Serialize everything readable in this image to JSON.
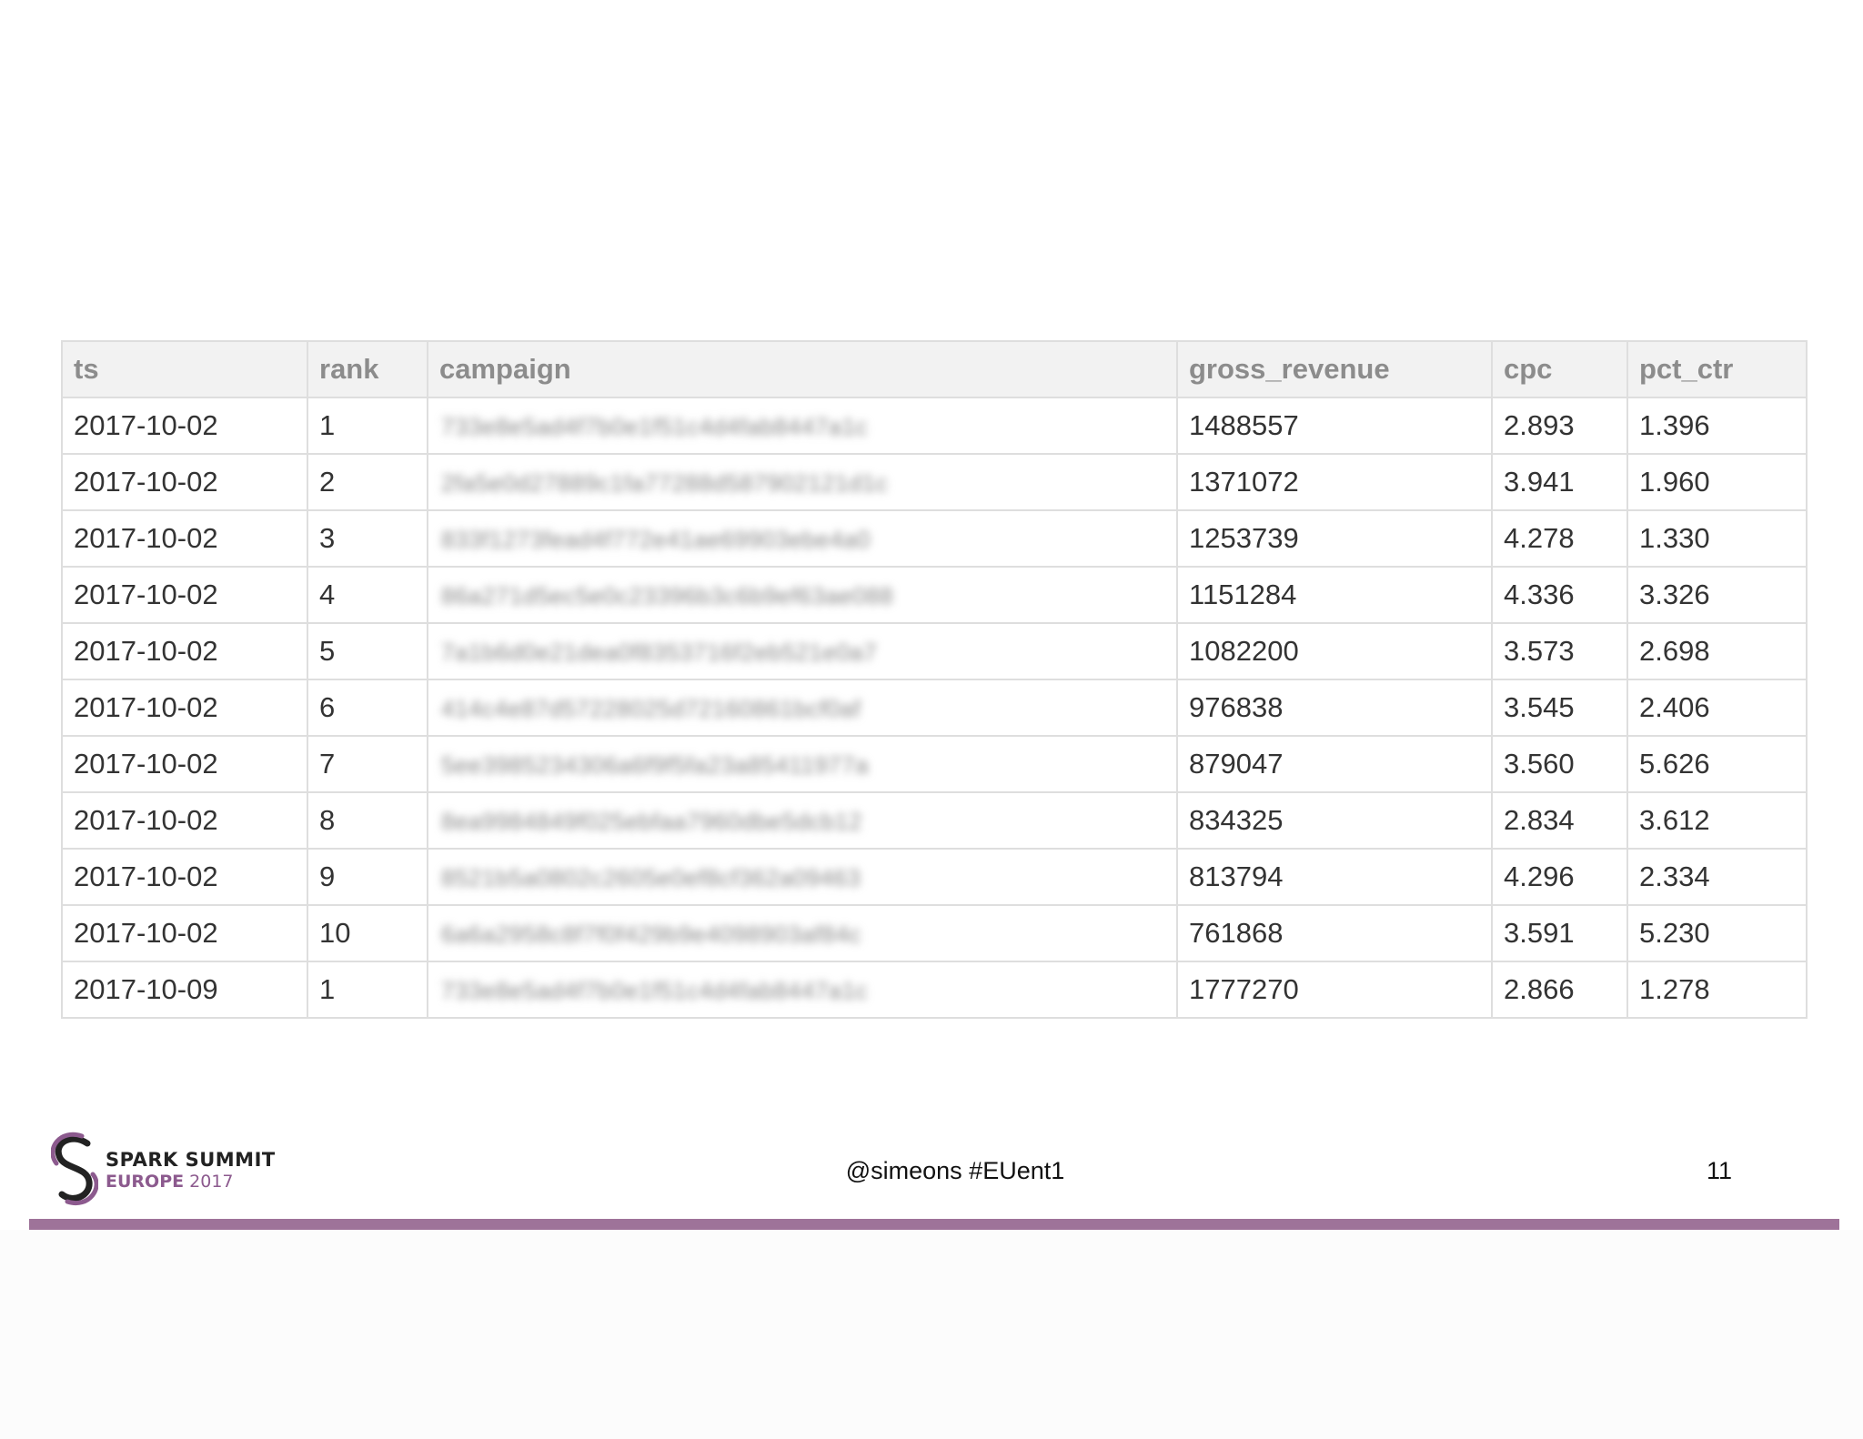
{
  "table": {
    "headers": [
      "ts",
      "rank",
      "campaign",
      "gross_revenue",
      "cpc",
      "pct_ctr"
    ],
    "rows": [
      {
        "ts": "2017-10-02",
        "rank": "1",
        "campaign": "733e8e5ad4f7b0e1f51c4d4fab8447a1c",
        "gross_revenue": "1488557",
        "cpc": "2.893",
        "pct_ctr": "1.396"
      },
      {
        "ts": "2017-10-02",
        "rank": "2",
        "campaign": "2fa5e0d27889c1fa77288d587902121d1c",
        "gross_revenue": "1371072",
        "cpc": "3.941",
        "pct_ctr": "1.960"
      },
      {
        "ts": "2017-10-02",
        "rank": "3",
        "campaign": "833f1273fead4f772e41ae69903ebe4a0",
        "gross_revenue": "1253739",
        "cpc": "4.278",
        "pct_ctr": "1.330"
      },
      {
        "ts": "2017-10-02",
        "rank": "4",
        "campaign": "86a271d5ec5e0c23396b3c6b9ef63ae088",
        "gross_revenue": "1151284",
        "cpc": "4.336",
        "pct_ctr": "3.326"
      },
      {
        "ts": "2017-10-02",
        "rank": "5",
        "campaign": "7a1b6d0e21dea0f8353716f2eb521e0a7",
        "gross_revenue": "1082200",
        "cpc": "3.573",
        "pct_ctr": "2.698"
      },
      {
        "ts": "2017-10-02",
        "rank": "6",
        "campaign": "414c4e87d57228025d72160861bcf0af",
        "gross_revenue": "976838",
        "cpc": "3.545",
        "pct_ctr": "2.406"
      },
      {
        "ts": "2017-10-02",
        "rank": "7",
        "campaign": "5ee3985234306a6f9f5fa23a85411977a",
        "gross_revenue": "879047",
        "cpc": "3.560",
        "pct_ctr": "5.626"
      },
      {
        "ts": "2017-10-02",
        "rank": "8",
        "campaign": "8ea9984849f025ebfaa7960dbe5dcb12",
        "gross_revenue": "834325",
        "cpc": "2.834",
        "pct_ctr": "3.612"
      },
      {
        "ts": "2017-10-02",
        "rank": "9",
        "campaign": "8521b5a0802c2605e0ef8cf362a09463",
        "gross_revenue": "813794",
        "cpc": "4.296",
        "pct_ctr": "2.334"
      },
      {
        "ts": "2017-10-02",
        "rank": "10",
        "campaign": "6a6a2958c8f7f0f429b9e4098903af84c",
        "gross_revenue": "761868",
        "cpc": "3.591",
        "pct_ctr": "5.230"
      },
      {
        "ts": "2017-10-09",
        "rank": "1",
        "campaign": "733e8e5ad4f7b0e1f51c4d4fab8447a1c",
        "gross_revenue": "1777270",
        "cpc": "2.866",
        "pct_ctr": "1.278"
      }
    ]
  },
  "footer": {
    "logo_line1": "SPARK SUMMIT",
    "logo_line2_word": "EUROPE",
    "logo_line2_year": "2017",
    "handle": "@simeons #EUent1",
    "page_number": "11"
  },
  "colors": {
    "accent_bar": "#9e7399",
    "logo_purple": "#8c5a8e"
  }
}
